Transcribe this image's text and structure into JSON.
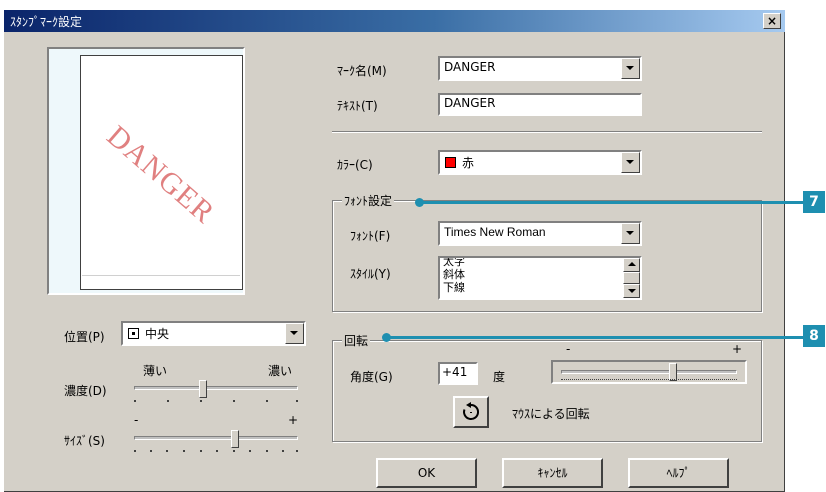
{
  "window": {
    "title": "ｽﾀﾝﾌﾟﾏｰｸ設定",
    "close_glyph": "×"
  },
  "preview": {
    "watermark_text": "DANGER",
    "watermark_color": "#e08080"
  },
  "mark_name": {
    "label": "ﾏｰｸ名(M)",
    "value": "DANGER"
  },
  "text_field": {
    "label": "ﾃｷｽﾄ(T)",
    "value": "DANGER"
  },
  "color": {
    "label": "ｶﾗｰ(C)",
    "value": "赤",
    "swatch": "#ff0000"
  },
  "font_group": {
    "title": "ﾌｫﾝﾄ設定",
    "font_label": "ﾌｫﾝﾄ(F)",
    "font_value": "Times New Roman",
    "style_label": "ｽﾀｲﾙ(Y)",
    "style_items": [
      "太字",
      "斜体",
      "下線"
    ]
  },
  "rotation_group": {
    "title": "回転",
    "angle_label": "角度(G)",
    "angle_value": "+41",
    "angle_unit": "度",
    "slider_minus": "-",
    "slider_plus": "+",
    "mouse_rotate_label": "ﾏｳｽによる回転",
    "rotate_icon": "rotate-icon"
  },
  "position": {
    "label": "位置(P)",
    "value": "中央"
  },
  "density": {
    "label": "濃度(D)",
    "low_label": "薄い",
    "high_label": "濃い"
  },
  "size": {
    "label": "ｻｲｽﾞ(S)",
    "minus": "-",
    "plus": "+"
  },
  "buttons": {
    "ok": "OK",
    "cancel": "ｷｬﾝｾﾙ",
    "help": "ﾍﾙﾌﾟ"
  },
  "callouts": {
    "seven": "7",
    "eight": "8",
    "color": "#1e8fb0"
  }
}
